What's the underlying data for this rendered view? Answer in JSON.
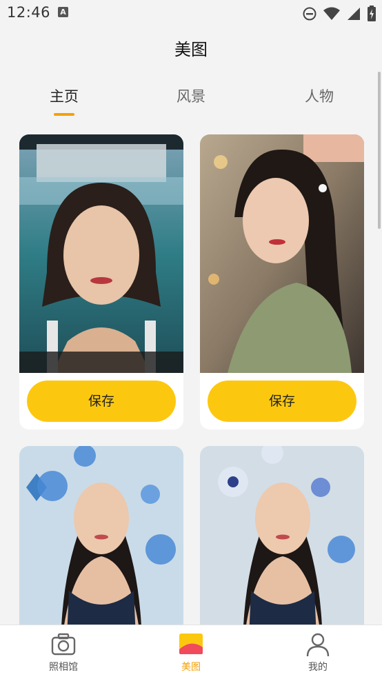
{
  "status_bar": {
    "time": "12:46",
    "notification_badge": "A"
  },
  "header": {
    "title": "美图"
  },
  "tabs": [
    {
      "label": "主页",
      "active": true
    },
    {
      "label": "风景",
      "active": false
    },
    {
      "label": "人物",
      "active": false
    }
  ],
  "cards": [
    {
      "save_label": "保存"
    },
    {
      "save_label": "保存"
    },
    {
      "save_label": ""
    },
    {
      "save_label": ""
    }
  ],
  "bottom_nav": [
    {
      "label": "照相馆",
      "icon": "camera-icon"
    },
    {
      "label": "美图",
      "icon": "gallery-icon",
      "active": true
    },
    {
      "label": "我的",
      "icon": "profile-icon"
    }
  ],
  "colors": {
    "accent": "#f5a000",
    "button": "#fcc80f"
  }
}
